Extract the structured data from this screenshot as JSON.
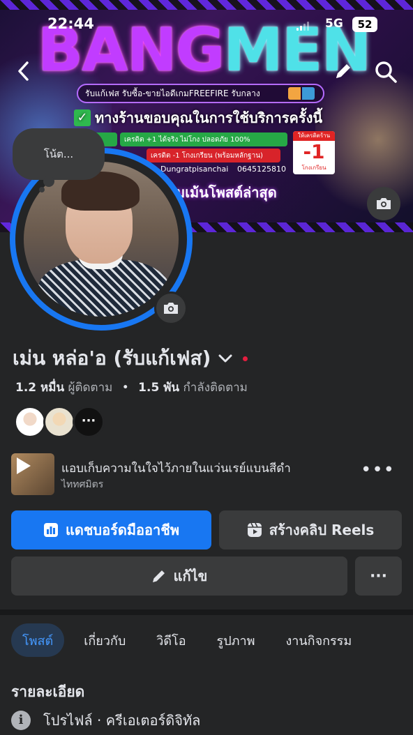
{
  "status_bar": {
    "time": "22:44",
    "network": "5G",
    "battery": "52"
  },
  "cover": {
    "logo_part1": "BANG",
    "logo_part2": "MEN",
    "tagline": "รับแก้เฟส รับซื้อ-ขายไอดีเกมFREEFIRE รับกลาง",
    "thanks": "ทางร้านขอบคุณในการใช้บริการครั้งนี้",
    "pill1": "ร้าน",
    "pill2": "เครดิต +1 ได้จริง ไม่โกง ปลอดภัย 100%",
    "pill3": "เครดิต -1 โกงเกรียน (พร้อมหลักฐาน)",
    "contact_name": "Dungratpisanchai",
    "contact_phone": "0645125810",
    "price_top": "ให้เครดิตร้าน",
    "price_num": "-1",
    "price_bot": "โกงเกรียน",
    "bottom_line": "อมเม้นโพสต์ล่าสุด"
  },
  "note": {
    "label": "โน้ต..."
  },
  "profile": {
    "name": "เม่น หล่อ'อ (รับแก้เฟส)",
    "followers_count": "1.2 หมื่น",
    "followers_label": "ผู้ติดตาม",
    "following_count": "1.5 พัน",
    "following_label": "กำลังติดตาม",
    "friends_more": "···"
  },
  "music": {
    "title": "แอบเก็บความในใจไว้ภายในแว่นเรย์แบนสีดำ",
    "artist": "ไททศมิตร"
  },
  "buttons": {
    "dashboard": "แดชบอร์ดมืออาชีพ",
    "reels": "สร้างคลิป Reels",
    "edit": "แก้ไข",
    "more": "···"
  },
  "tabs": [
    {
      "label": "โพสต์",
      "active": true
    },
    {
      "label": "เกี่ยวกับ",
      "active": false
    },
    {
      "label": "วิดีโอ",
      "active": false
    },
    {
      "label": "รูปภาพ",
      "active": false
    },
    {
      "label": "งานกิจกรรม",
      "active": false
    }
  ],
  "details": {
    "title": "รายละเอียด",
    "profile_type": "โปรไฟล์ · ครีเอเตอร์ดิจิทัล"
  },
  "colors": {
    "accent": "#1877f2",
    "background": "#242526",
    "surface": "#3a3b3c"
  }
}
